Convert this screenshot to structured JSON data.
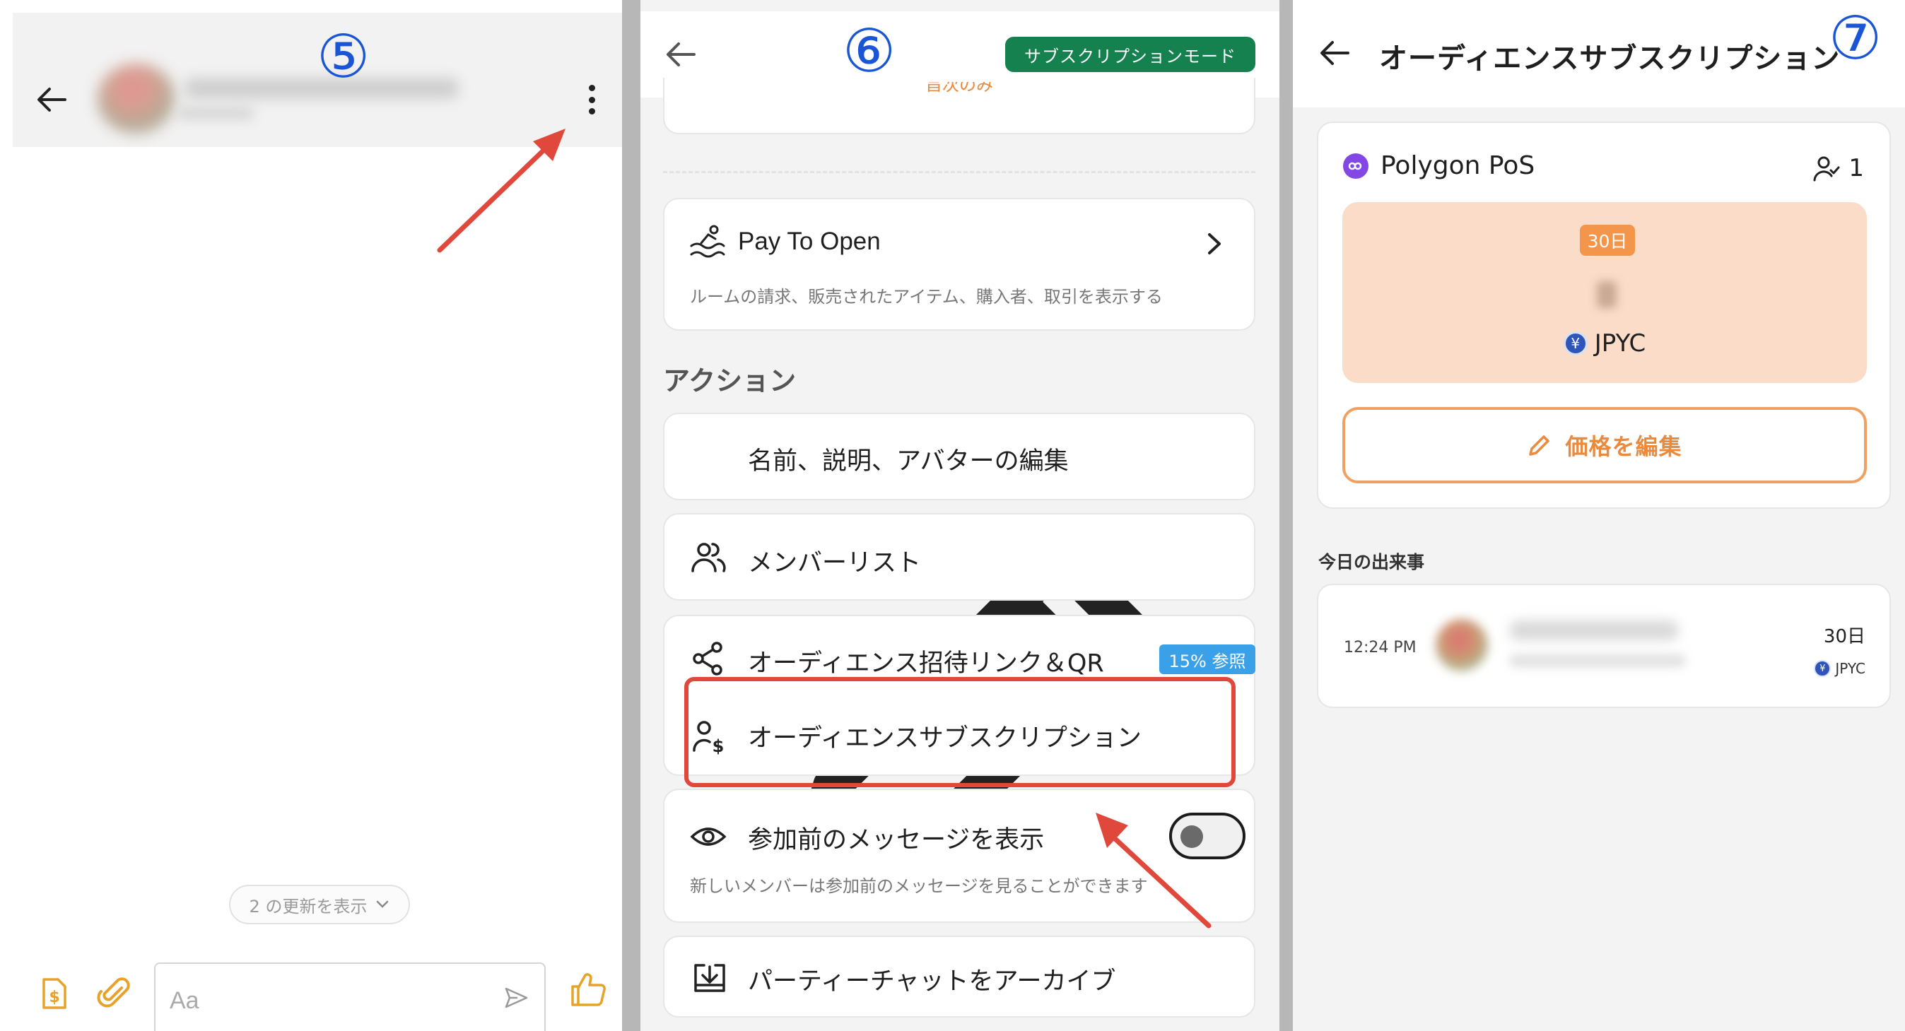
{
  "steps": {
    "s5": "⑤",
    "s6": "⑥",
    "s7": "⑦"
  },
  "panel5": {
    "updates_label": "2 の更新を表示",
    "input_placeholder": "Aa"
  },
  "panel6": {
    "mode_badge": "サブスクリプションモード",
    "cutoff_text": "旨次のみ",
    "pay_to_open": {
      "title": "Pay To Open",
      "description": "ルームの請求、販売されたアイテム、購入者、取引を表示する"
    },
    "section_title": "アクション",
    "actions": {
      "edit": "名前、説明、アバターの編集",
      "members": "メンバーリスト",
      "invite": "オーディエンス招待リンク＆QR",
      "invite_badge": "15% 参照",
      "subscription": "オーディエンスサブスクリプション",
      "show_messages": "参加前のメッセージを表示",
      "show_messages_desc": "新しいメンバーは参加前のメッセージを見ることができます",
      "show_messages_on": false,
      "archive": "パーティーチャットをアーカイブ"
    }
  },
  "panel7": {
    "title": "オーディエンスサブスクリプション",
    "chain": "Polygon PoS",
    "member_count": "1",
    "period_tag": "30日",
    "token": "JPYC",
    "edit_price": "価格を編集",
    "today_heading": "今日の出来事",
    "event": {
      "time": "12:24 PM",
      "period": "30日",
      "token": "JPYC"
    }
  },
  "colors": {
    "accent_orange": "#f0a060",
    "mode_green": "#14814f",
    "highlight_red": "#e0483c",
    "step_blue": "#1a55d6",
    "badge_blue": "#3aa0e8"
  },
  "icons": {
    "back": "arrow-left-icon",
    "menu": "kebab-menu-icon",
    "pay": "pay-to-open-icon",
    "edit": "pencil-icon",
    "members": "users-icon",
    "share": "share-icon",
    "subscription": "user-dollar-icon",
    "eye": "eye-icon",
    "archive": "archive-icon",
    "send": "send-icon",
    "attach": "paperclip-icon",
    "like": "thumbs-up-icon",
    "dollar_file": "dollar-document-icon"
  }
}
